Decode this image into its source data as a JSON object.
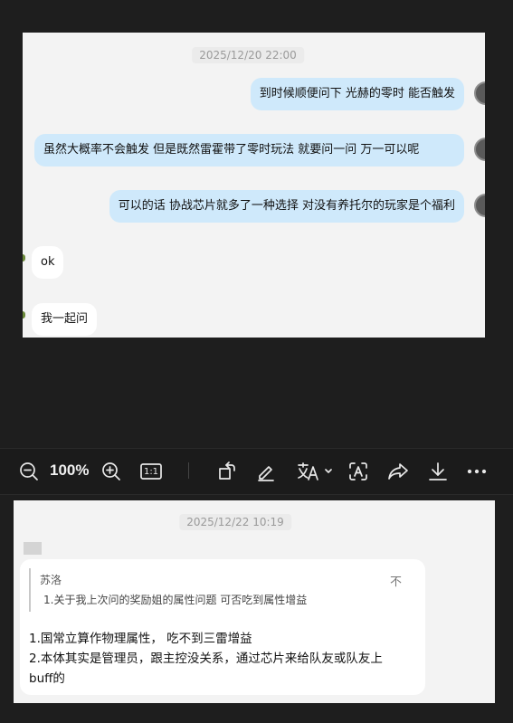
{
  "top_chat": {
    "timestamp": "2025/12/20 22:00",
    "messages": [
      {
        "side": "mine",
        "text": "到时候顺便问下 光赫的零时 能否触发"
      },
      {
        "side": "mine",
        "text": "虽然大概率不会触发  但是既然雷霍带了零时玩法 就要问一问  万一可以呢"
      },
      {
        "side": "mine",
        "text": "可以的话  协战芯片就多了一种选择 对没有养托尔的玩家是个福利"
      },
      {
        "side": "other",
        "text": "ok"
      },
      {
        "side": "other",
        "text": "我一起问"
      }
    ]
  },
  "toolbar": {
    "zoom_value": "100%",
    "icons": [
      "zoom-out-icon",
      "zoom-in-icon",
      "actual-size-icon",
      "rotate-icon",
      "edit-icon",
      "translate-icon",
      "ocr-icon",
      "share-icon",
      "download-icon",
      "more-icon"
    ],
    "actual_size_label": "1:1"
  },
  "bottom_chat": {
    "timestamp": "2025/12/22 10:19",
    "quote": {
      "name": "苏洛",
      "text": "1.关于我上次问的奖励姐的属性问题 可否吃到属性增益",
      "pin_glyph": "不"
    },
    "lines": [
      "1.国常立算作物理属性，  吃不到三雷增益",
      "2.本体其实是管理员，跟主控没关系，通过芯片来给队友或队友上",
      "buff的"
    ]
  }
}
